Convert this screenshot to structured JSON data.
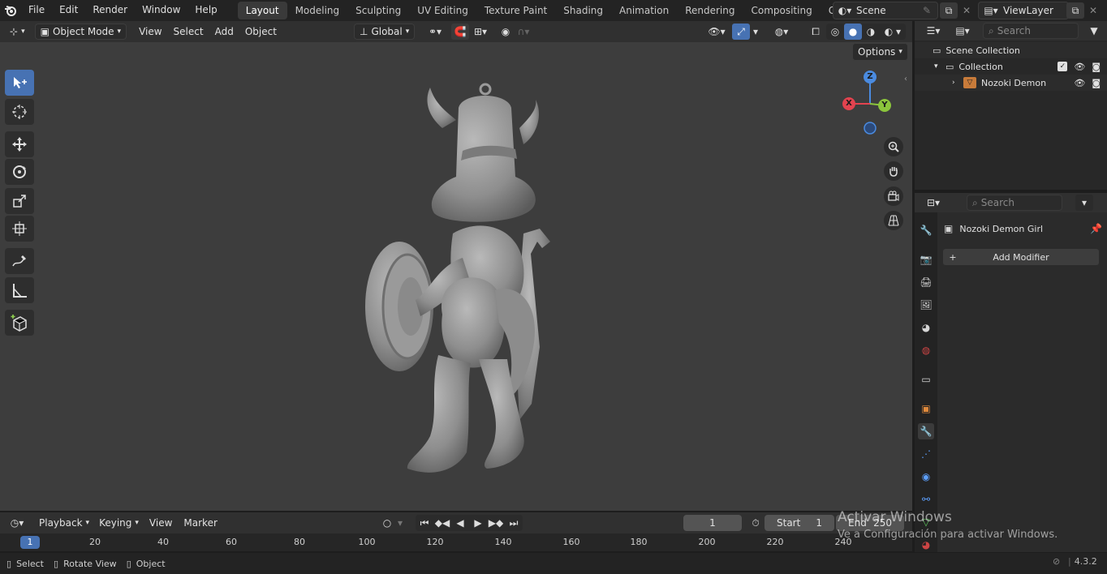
{
  "menu": [
    "File",
    "Edit",
    "Render",
    "Window",
    "Help"
  ],
  "workspaces": [
    "Layout",
    "Modeling",
    "Sculpting",
    "UV Editing",
    "Texture Paint",
    "Shading",
    "Animation",
    "Rendering",
    "Compositing",
    "Geometry Node"
  ],
  "active_workspace": "Layout",
  "scene": {
    "name": "Scene"
  },
  "view_layer": {
    "name": "ViewLayer"
  },
  "viewport_header": {
    "mode": "Object Mode",
    "menus": [
      "View",
      "Select",
      "Add",
      "Object"
    ],
    "transform_orientation": "Global",
    "options_label": "Options"
  },
  "gizmo_axes": {
    "x": "X",
    "y": "Y",
    "z": "Z"
  },
  "outliner": {
    "search_placeholder": "Search",
    "scene_collection": "Scene Collection",
    "collection": "Collection",
    "object": "Nozoki Demon"
  },
  "properties": {
    "search_placeholder": "Search",
    "object_name": "Nozoki Demon Girl",
    "add_modifier": "Add Modifier"
  },
  "timeline": {
    "menus": [
      "Playback",
      "Keying",
      "View",
      "Marker"
    ],
    "current_frame": "1",
    "start_label": "Start",
    "start_value": "1",
    "end_label": "End",
    "end_value": "250",
    "ruler_current": "1",
    "ruler_ticks": [
      "20",
      "40",
      "60",
      "80",
      "100",
      "120",
      "140",
      "160",
      "180",
      "200",
      "220",
      "240"
    ]
  },
  "status_bar": {
    "select": "Select",
    "rotate_view": "Rotate View",
    "object": "Object",
    "version": "4.3.2"
  },
  "watermark": {
    "title": "Activar Windows",
    "subtitle": "Ve a Configuración para activar Windows."
  },
  "colors": {
    "accent": "#4772b3",
    "axis_x": "#e2434f",
    "axis_y": "#8bc53c",
    "axis_z": "#4a8be0"
  }
}
